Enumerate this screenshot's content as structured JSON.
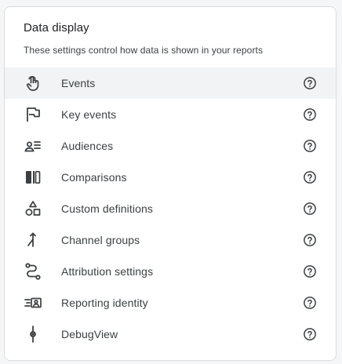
{
  "card": {
    "title": "Data display",
    "subtitle": "These settings control how data is shown in your reports"
  },
  "items": [
    {
      "label": "Events",
      "icon": "touch-icon",
      "active": true
    },
    {
      "label": "Key events",
      "icon": "flag-icon",
      "active": false
    },
    {
      "label": "Audiences",
      "icon": "audience-icon",
      "active": false
    },
    {
      "label": "Comparisons",
      "icon": "comparisons-icon",
      "active": false
    },
    {
      "label": "Custom definitions",
      "icon": "shapes-icon",
      "active": false
    },
    {
      "label": "Channel groups",
      "icon": "merge-icon",
      "active": false
    },
    {
      "label": "Attribution settings",
      "icon": "route-icon",
      "active": false
    },
    {
      "label": "Reporting identity",
      "icon": "identity-icon",
      "active": false
    },
    {
      "label": "DebugView",
      "icon": "debug-icon",
      "active": false
    }
  ],
  "colors": {
    "icon": "#3c4043",
    "active_bg": "#f1f3f4",
    "border": "#dadce0"
  }
}
